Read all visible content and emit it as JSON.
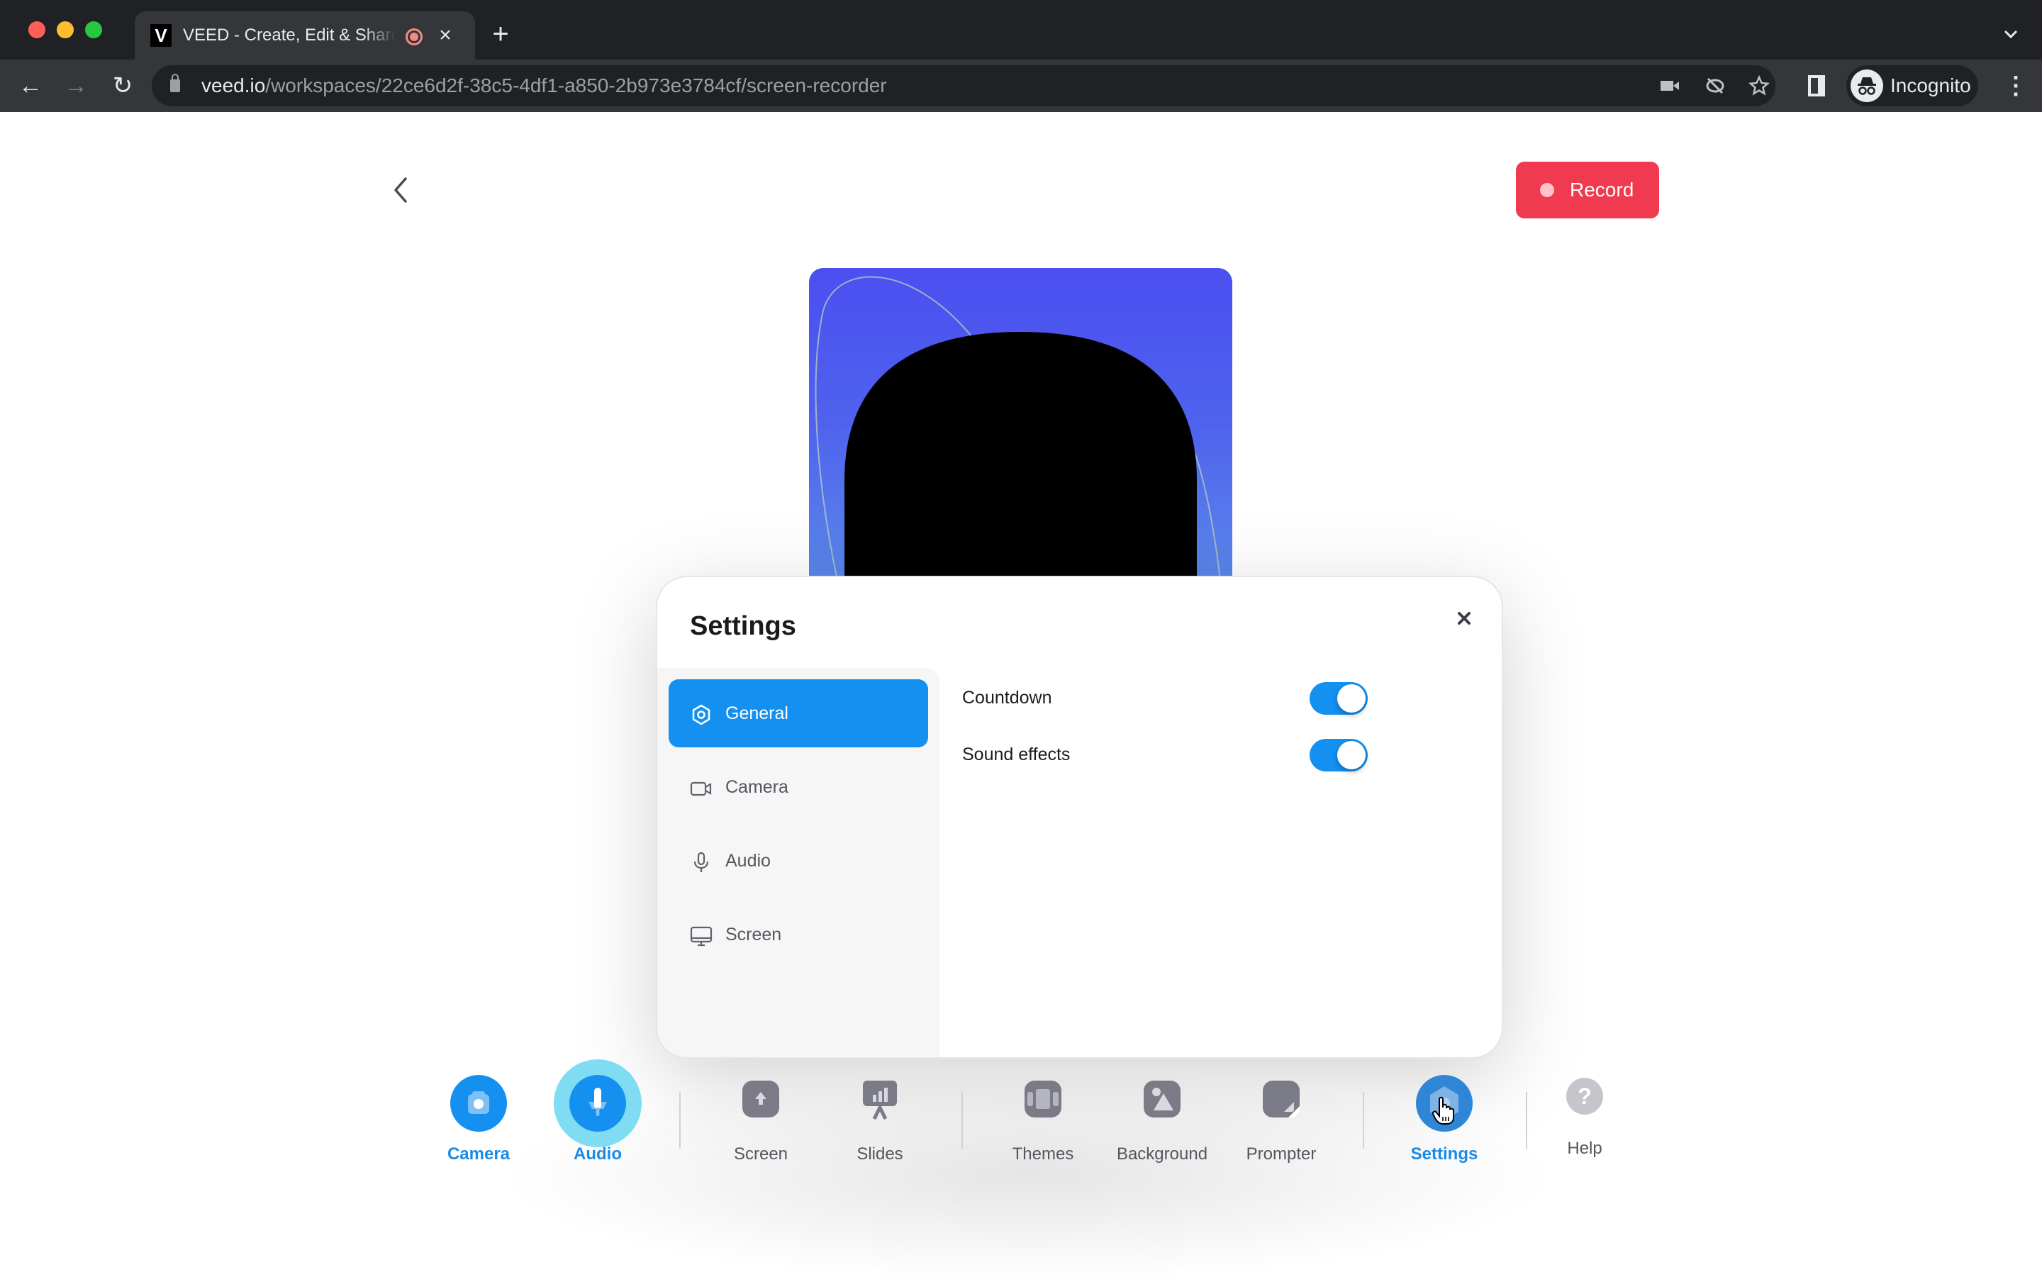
{
  "browser": {
    "tab_title": "VEED - Create, Edit & Share Videos",
    "favicon_letter": "V",
    "close_tab_glyph": "×",
    "new_tab_glyph": "+",
    "tab_menu_glyph": "⌄",
    "url_host": "veed.io",
    "url_path": "/workspaces/22ce6d2f-38c5-4df1-a850-2b973e3784cf/screen-recorder",
    "profile_label": "Incognito",
    "nav": {
      "back": "←",
      "forward": "→",
      "reload": "↻"
    },
    "menu_glyph": "⋮"
  },
  "page": {
    "back_glyph": "‹",
    "record_label": "Record",
    "colors": {
      "record": "#f03a50",
      "accent": "#1390f0",
      "preview_bg": "#4b4ff0"
    }
  },
  "settings_modal": {
    "title": "Settings",
    "close_glyph": "×",
    "nav": [
      {
        "label": "General",
        "icon": "gear-icon",
        "active": true
      },
      {
        "label": "Camera",
        "icon": "video-camera-icon",
        "active": false
      },
      {
        "label": "Audio",
        "icon": "microphone-icon",
        "active": false
      },
      {
        "label": "Screen",
        "icon": "monitor-icon",
        "active": false
      }
    ],
    "general": [
      {
        "label": "Countdown",
        "enabled": true
      },
      {
        "label": "Sound effects",
        "enabled": true
      }
    ]
  },
  "dock": {
    "items": [
      {
        "label": "Camera",
        "icon": "camera-icon",
        "active": true
      },
      {
        "label": "Audio",
        "icon": "microphone-icon",
        "active": true
      },
      {
        "label": "Screen",
        "icon": "screen-share-icon",
        "active": false
      },
      {
        "label": "Slides",
        "icon": "presentation-icon",
        "active": false
      },
      {
        "label": "Themes",
        "icon": "themes-icon",
        "active": false
      },
      {
        "label": "Background",
        "icon": "image-icon",
        "active": false
      },
      {
        "label": "Prompter",
        "icon": "note-icon",
        "active": false
      },
      {
        "label": "Settings",
        "icon": "gear-icon",
        "active": true
      },
      {
        "label": "Help",
        "icon": "help-icon",
        "active": false
      }
    ],
    "help_glyph": "?"
  }
}
